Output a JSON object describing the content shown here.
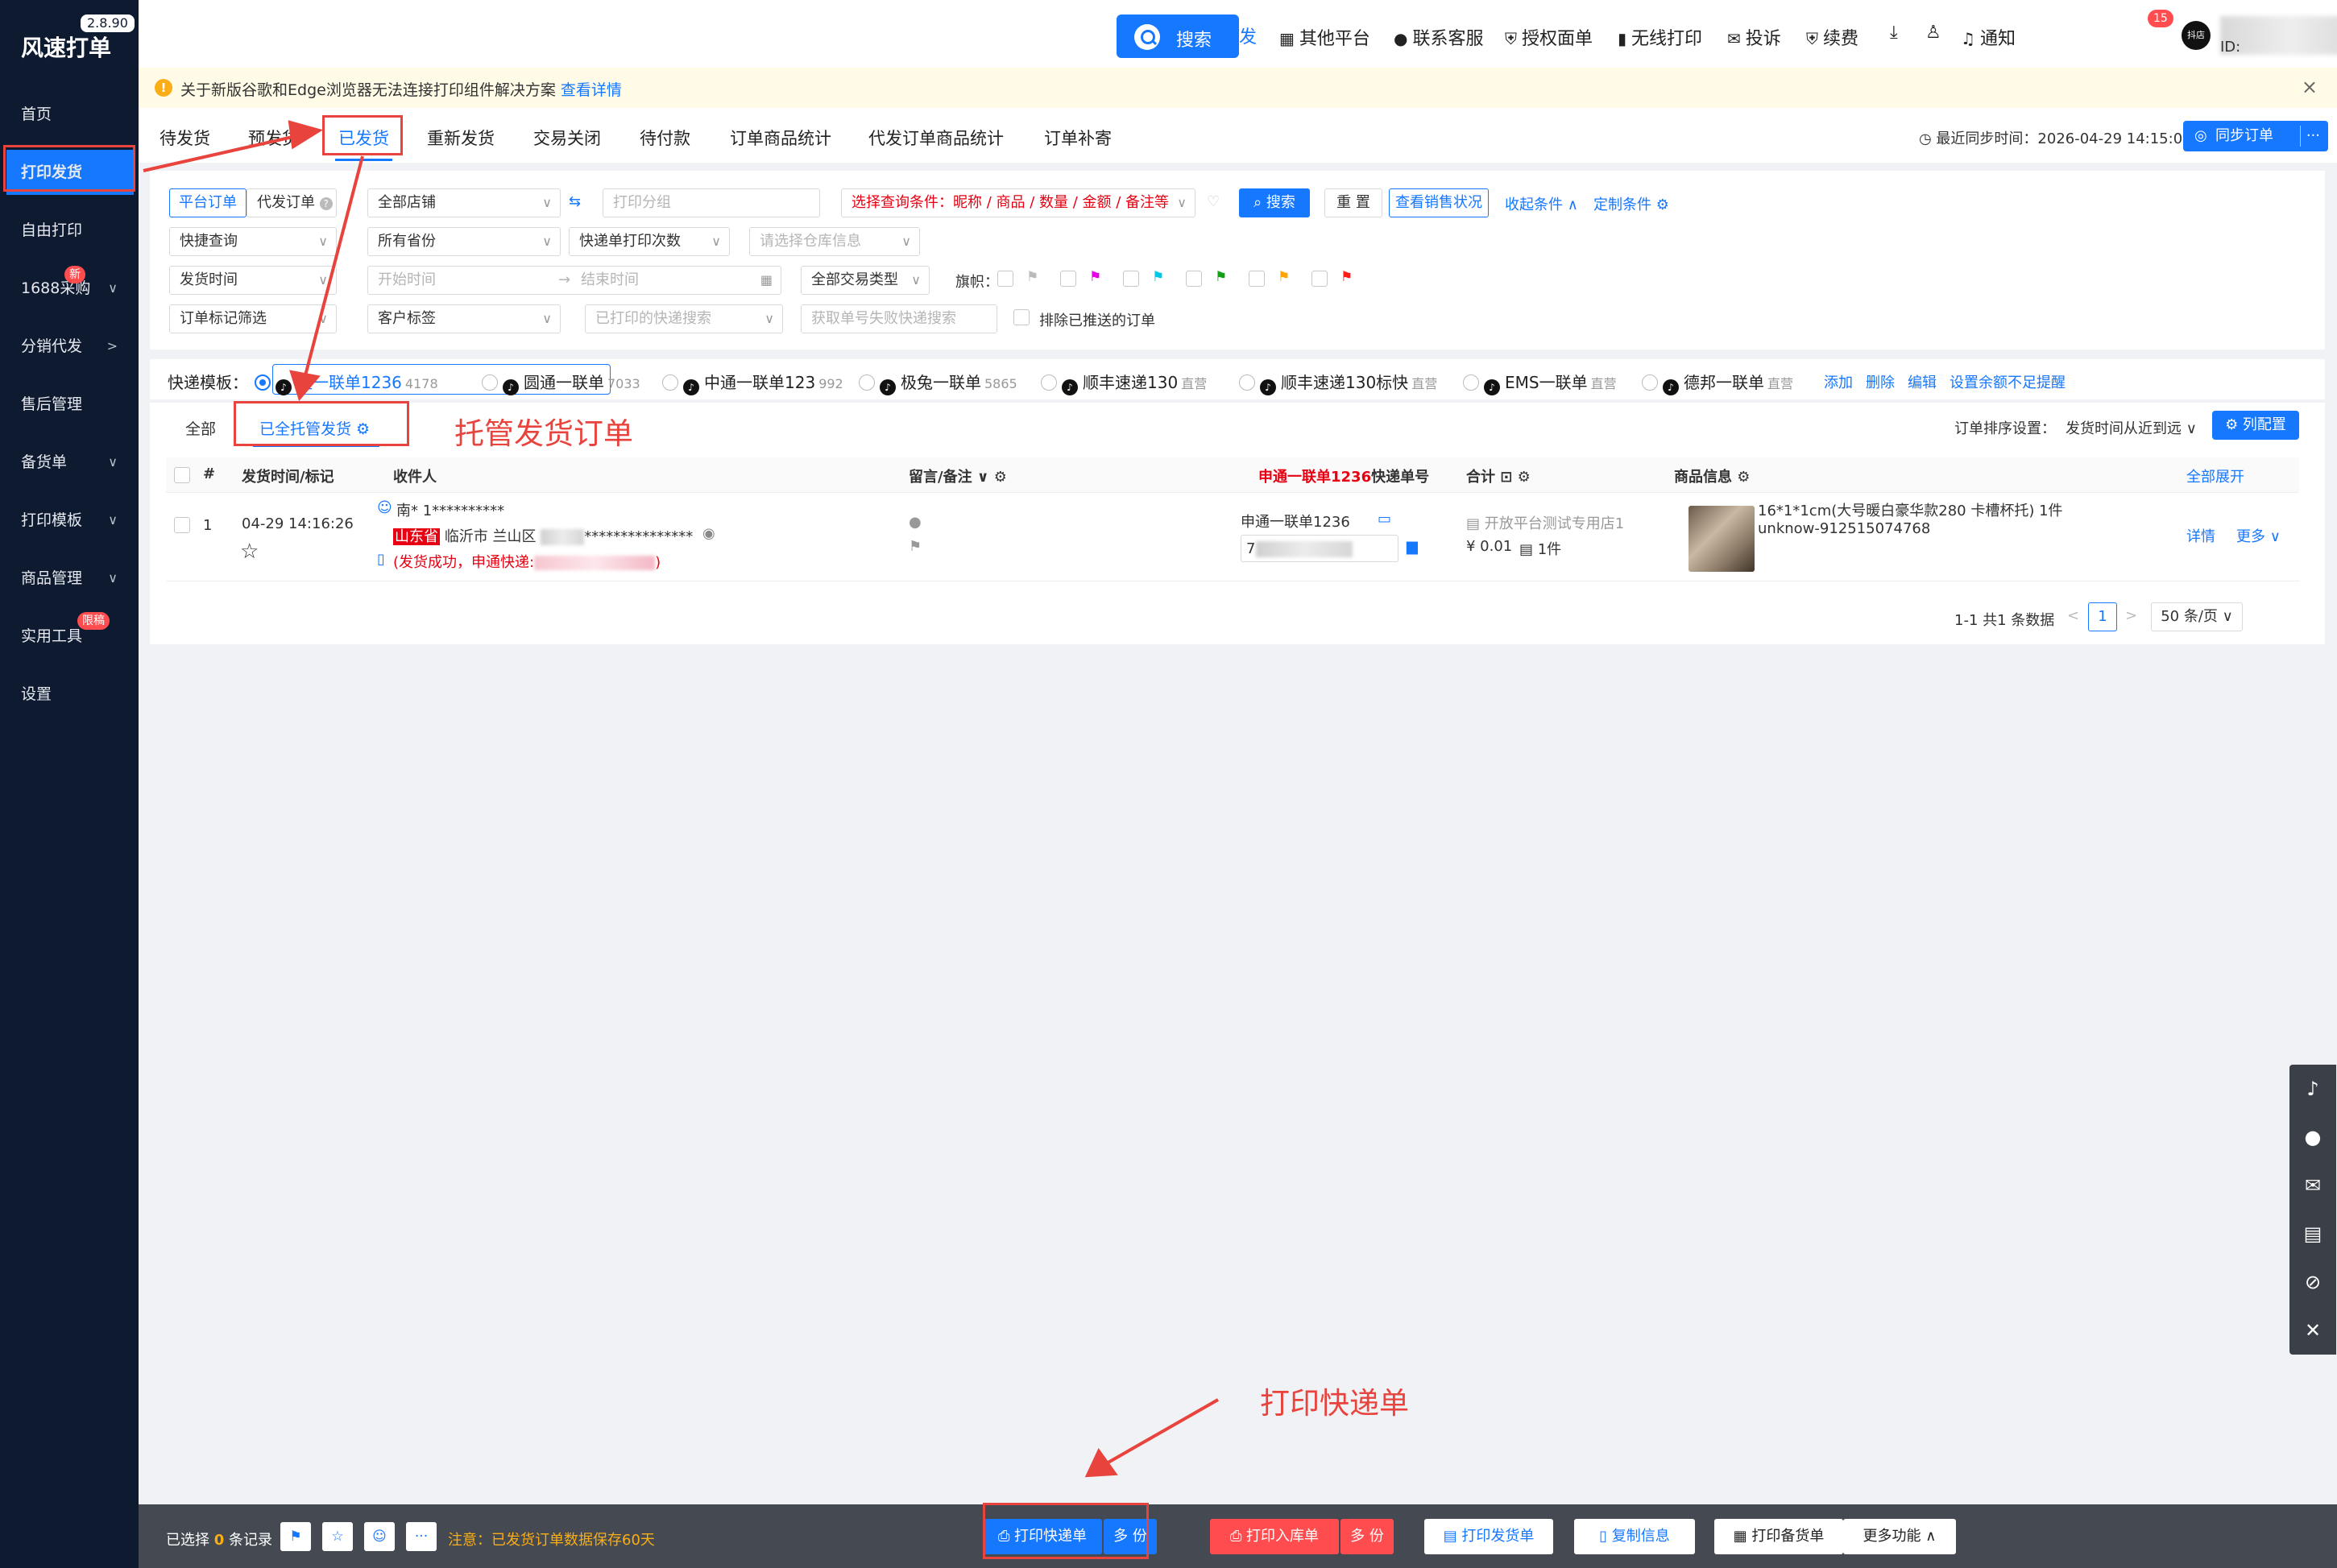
{
  "app": {
    "name": "风速打单",
    "version": "2.8.90"
  },
  "sidebar": {
    "items": [
      {
        "label": "首页",
        "caret": ""
      },
      {
        "label": "打印发货",
        "caret": ""
      },
      {
        "label": "自由打印",
        "caret": ""
      },
      {
        "label": "1688采购",
        "caret": "∨",
        "badge": "新"
      },
      {
        "label": "分销代发",
        "caret": ">"
      },
      {
        "label": "售后管理",
        "caret": ""
      },
      {
        "label": "备货单",
        "caret": "∨"
      },
      {
        "label": "打印模板",
        "caret": "∨"
      },
      {
        "label": "商品管理",
        "caret": "∨"
      },
      {
        "label": "实用工具",
        "caret": "",
        "badge": "限稿"
      },
      {
        "label": "设置",
        "caret": ""
      }
    ]
  },
  "header": {
    "search_label": "搜索",
    "search_clipped": "发",
    "links": [
      {
        "icon": "grid-icon",
        "glyph": "▦",
        "label": "其他平台"
      },
      {
        "icon": "service-icon",
        "glyph": "●",
        "label": "联系客服"
      },
      {
        "icon": "shield-icon",
        "glyph": "⛨",
        "label": "授权面单"
      },
      {
        "icon": "phone-icon",
        "glyph": "▮",
        "label": "无线打印"
      },
      {
        "icon": "mail-icon",
        "glyph": "✉",
        "label": "投诉"
      },
      {
        "icon": "renew-icon",
        "glyph": "⛨",
        "label": "续费"
      }
    ],
    "download_glyph": "⤓",
    "shirt_glyph": "♙",
    "notify_label": "通知",
    "notify_count": "15",
    "shop_badge": "抖店",
    "user_id_prefix": "ID:"
  },
  "notice": {
    "text": "关于新版谷歌和Edge浏览器无法连接打印组件解决方案",
    "link": "查看详情",
    "close": "×"
  },
  "tabs": {
    "items": [
      "待发货",
      "预发货",
      "已发货",
      "重新发货",
      "交易关闭",
      "待付款",
      "订单商品统计",
      "代发订单商品统计",
      "订单补寄"
    ],
    "active_index": 2,
    "sync_time": "◷ 最近同步时间：2026-04-29 14:15:06",
    "sync_button": "同步订单",
    "sync_more": "···"
  },
  "filters": {
    "platform_order": "平台订单",
    "agent_order": "代发订单",
    "agent_help": "?",
    "shop_select": "全部店铺",
    "swap_glyph": "⇆",
    "print_group_ph": "打印分组",
    "query_cond": "选择查询条件：昵称 / 商品 / 数量 / 金额 / 备注等",
    "search_btn": "搜索",
    "reset_btn": "重 置",
    "sales_btn": "查看销售状况",
    "collapse_link": "收起条件 ∧",
    "custom_link": "定制条件 ⚙",
    "quick_query": "快捷查询",
    "province": "所有省份",
    "print_times": "快递单打印次数",
    "warehouse_ph": "请选择仓库信息",
    "ship_time": "发货时间",
    "start_ph": "开始时间",
    "to_glyph": "→",
    "end_ph": "结束时间",
    "trade_type": "全部交易类型",
    "flag_label": "旗帜：",
    "flags": [
      {
        "color": "#bbbbbb"
      },
      {
        "color": "#e600e6"
      },
      {
        "color": "#00c8e6"
      },
      {
        "color": "#14a014"
      },
      {
        "color": "#ffa500"
      },
      {
        "color": "#ff1a1a"
      }
    ],
    "order_mark": "订单标记筛选",
    "customer_tag": "客户标签",
    "printed_search_ph": "已打印的快递搜索",
    "fail_search_ph": "获取单号失败快递搜索",
    "exclude_pushed": "排除已推送的订单"
  },
  "templates": {
    "label": "快递模板：",
    "items": [
      {
        "name": "申通一联单1236",
        "count": "4178",
        "selected": true
      },
      {
        "name": "圆通一联单",
        "count": "7033",
        "selected": false
      },
      {
        "name": "中通一联单123",
        "count": "992",
        "selected": false
      },
      {
        "name": "极兔一联单",
        "count": "5865",
        "selected": false
      },
      {
        "name": "顺丰速递130",
        "count": "直营",
        "selected": false
      },
      {
        "name": "顺丰速递130标快",
        "count": "直营",
        "selected": false
      },
      {
        "name": "EMS一联单",
        "count": "直营",
        "selected": false
      },
      {
        "name": "德邦一联单",
        "count": "直营",
        "selected": false
      }
    ],
    "selected_name_clipped": "通一联单1236",
    "actions": [
      "添加",
      "删除",
      "编辑",
      "设置余额不足提醒"
    ]
  },
  "panel": {
    "subtab_all": "全部",
    "subtab_tuoguan": "已全托管发货 ⚙",
    "sort_label": "订单排序设置：",
    "sort_value": "发货时间从近到远 ∨",
    "col_config": "⚙ 列配置",
    "columns": {
      "index": "#",
      "ship_time": "发货时间/标记",
      "receiver": "收件人",
      "remark": "留言/备注 ∨ ⚙",
      "track_prefix": "申通一联单1236",
      "track_suffix": "快递单号",
      "total": "合计 ⊡ ⚙",
      "goods": "商品信息 ⚙",
      "expand_all": "全部展开"
    },
    "row": {
      "index": "1",
      "ship_time": "04-29 14:16:26",
      "star": "☆",
      "receiver_name": "南* 1**********",
      "province": "山东省",
      "city_district": "临沂市 兰山区",
      "address_mask": "***************",
      "eye": "◉",
      "ship_status": "(发货成功，申通快递:",
      "ship_status_end": ")",
      "track_template": "申通一联单1236",
      "track_no_start": "7",
      "shop_name": "开放平台测试专用店1",
      "price": "¥ 0.01",
      "qty": "1件",
      "goods_title": "16*1*1cm(大号暖白豪华款280 卡槽杯托) 1件",
      "goods_sku": "unknow-912515074768",
      "detail": "详情",
      "more": "更多 ∨"
    },
    "pager": {
      "summary": "1-1 共1 条数据",
      "prev": "<",
      "page": "1",
      "next": ">",
      "page_size": "50 条/页 ∨"
    }
  },
  "float_bar": [
    "♪",
    "●",
    "✉",
    "▤",
    "⊘",
    "✕"
  ],
  "bottom": {
    "selected_prefix": "已选择",
    "selected_count": "0",
    "selected_suffix": "条记录",
    "icons": [
      "⚑",
      "☆",
      "☺",
      "···"
    ],
    "note": "注意：已发货订单数据保存60天",
    "print_express": "⎙ 打印快递单",
    "copies1": "多 份",
    "print_inbound": "⎙ 打印入库单",
    "copies2": "多 份",
    "print_ship": "▤ 打印发货单",
    "copy_info": "▯ 复制信息",
    "print_stock": "▦ 打印备货单",
    "more_func": "更多功能 ∧"
  },
  "annotations": {
    "tuoguan_caption": "托管发货订单",
    "print_caption": "打印快递单",
    "color": "#e8433d"
  }
}
